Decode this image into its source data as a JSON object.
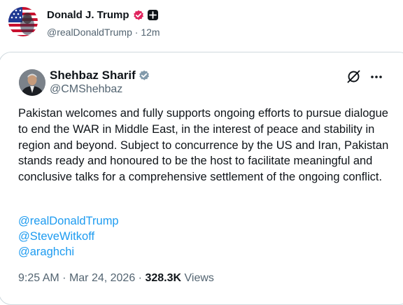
{
  "post": {
    "author_name": "Donald J. Trump",
    "author_handle": "@realDonaldTrump",
    "separator": "·",
    "time_ago": "12m",
    "colors": {
      "verified_badge": "#e0245e"
    },
    "icons": [
      "flag-avatar-icon",
      "verified-badge-icon",
      "affiliate-badge-icon"
    ]
  },
  "quoted_post": {
    "author_name": "Shehbaz Sharif",
    "author_handle": "@CMShehbaz",
    "body": "Pakistan welcomes and fully supports ongoing efforts to pursue dialogue to end the WAR in Middle East, in the interest of peace and stability in region and beyond. Subject to concurrence by the US and Iran, Pakistan stands ready and honoured to be the host to facilitate meaningful and conclusive talks for a comprehensive settlement of the ongoing conflict.",
    "mentions": [
      "@realDonaldTrump",
      "@SteveWitkoff",
      "@araghchi"
    ],
    "time": "9:25 AM",
    "separator": "·",
    "date": "Mar 24, 2026",
    "views_count": "328.3K",
    "views_label": "Views",
    "colors": {
      "mention": "#1d9bf0",
      "verified_badge": "#829aab"
    },
    "icons": [
      "verified-badge-icon",
      "grok-icon",
      "more-icon"
    ]
  }
}
